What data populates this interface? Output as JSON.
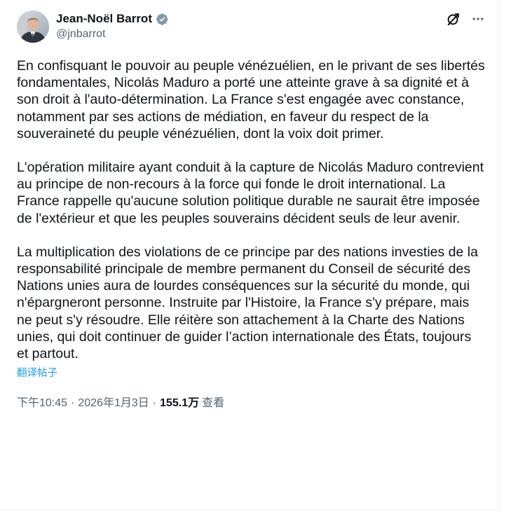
{
  "author": {
    "display_name": "Jean-Noël Barrot",
    "handle": "@jnbarrot",
    "verified_badge_color": "#829aab"
  },
  "icons": {
    "grok": "grok-slash-circle-icon",
    "more": "more-horizontal-icon",
    "verified": "verified-badge-icon"
  },
  "tweet": {
    "paragraphs": [
      "En confisquant le pouvoir au peuple vénézuélien, en le privant de ses libertés fondamentales, Nicolás Maduro a porté une atteinte grave à sa dignité et à son droit à l'auto-détermination. La France s'est engagée avec constance, notamment par ses actions de médiation, en faveur du respect de la souveraineté du peuple vénézuélien, dont la voix doit primer.",
      "L'opération militaire ayant conduit à la capture de Nicolás Maduro contrevient au principe de non-recours à la force qui fonde le droit international. La France rappelle qu'aucune solution politique durable ne saurait être imposée de l'extérieur et que les peuples souverains décident seuls de leur avenir.",
      "La multiplication des violations de ce principe par des nations investies de la responsabilité principale de membre permanent du Conseil de sécurité des Nations unies aura de lourdes conséquences sur la sécurité du monde, qui n'épargneront personne. Instruite par l'Histoire, la France s'y prépare, mais ne peut s'y résoudre. Elle réitère son attachement à la Charte des Nations unies, qui doit continuer de guider l’action internationale des États, toujours et partout."
    ],
    "translate_label": "翻译帖子"
  },
  "meta": {
    "time": "下午10:45",
    "separator": "·",
    "date": "2026年1月3日",
    "views_count": "155.1万",
    "views_label": "查看"
  },
  "colors": {
    "text": "#0f1419",
    "secondary": "#536471",
    "link": "#1d9bf0"
  }
}
